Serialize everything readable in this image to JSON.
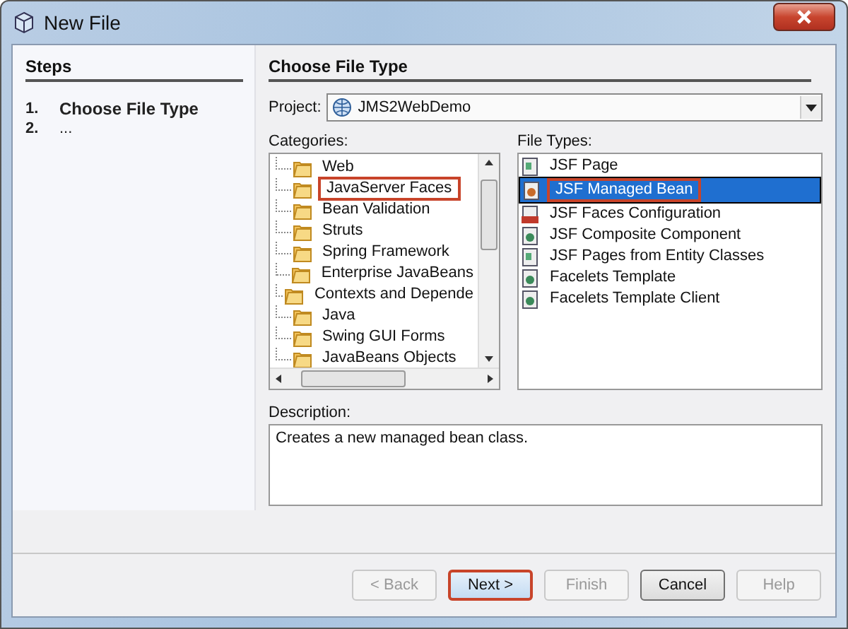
{
  "window": {
    "title": "New File"
  },
  "steps": {
    "heading": "Steps",
    "items": [
      {
        "number": "1.",
        "label": "Choose File Type",
        "selected": true
      },
      {
        "number": "2.",
        "label": "...",
        "selected": false
      }
    ]
  },
  "panel": {
    "heading": "Choose File Type",
    "project_label": "Project:",
    "project_value": "JMS2WebDemo"
  },
  "categories": {
    "label": "Categories:",
    "items": [
      {
        "label": "Web",
        "highlighted": false
      },
      {
        "label": "JavaServer Faces",
        "highlighted": true
      },
      {
        "label": "Bean Validation",
        "highlighted": false
      },
      {
        "label": "Struts",
        "highlighted": false
      },
      {
        "label": "Spring Framework",
        "highlighted": false
      },
      {
        "label": "Enterprise JavaBeans",
        "highlighted": false
      },
      {
        "label": "Contexts and Depende",
        "highlighted": false
      },
      {
        "label": "Java",
        "highlighted": false
      },
      {
        "label": "Swing GUI Forms",
        "highlighted": false
      },
      {
        "label": "JavaBeans Objects",
        "highlighted": false
      }
    ]
  },
  "file_types": {
    "label": "File Types:",
    "items": [
      {
        "label": "JSF Page",
        "kind": "page",
        "selected": false,
        "highlighted": false
      },
      {
        "label": "JSF Managed Bean",
        "kind": "bean",
        "selected": true,
        "highlighted": true
      },
      {
        "label": "JSF Faces Configuration",
        "kind": "config",
        "selected": false,
        "highlighted": false
      },
      {
        "label": "JSF Composite Component",
        "kind": "globe",
        "selected": false,
        "highlighted": false
      },
      {
        "label": "JSF Pages from Entity Classes",
        "kind": "page",
        "selected": false,
        "highlighted": false
      },
      {
        "label": "Facelets Template",
        "kind": "globe",
        "selected": false,
        "highlighted": false
      },
      {
        "label": "Facelets Template Client",
        "kind": "globe",
        "selected": false,
        "highlighted": false
      }
    ]
  },
  "description": {
    "label": "Description:",
    "text": "Creates a new managed bean class."
  },
  "buttons": [
    {
      "label": "< Back",
      "disabled": true,
      "highlighted": false
    },
    {
      "label": "Next >",
      "disabled": false,
      "highlighted": true
    },
    {
      "label": "Finish",
      "disabled": true,
      "highlighted": false
    },
    {
      "label": "Cancel",
      "disabled": false,
      "highlighted": false
    },
    {
      "label": "Help",
      "disabled": true,
      "highlighted": false
    }
  ]
}
